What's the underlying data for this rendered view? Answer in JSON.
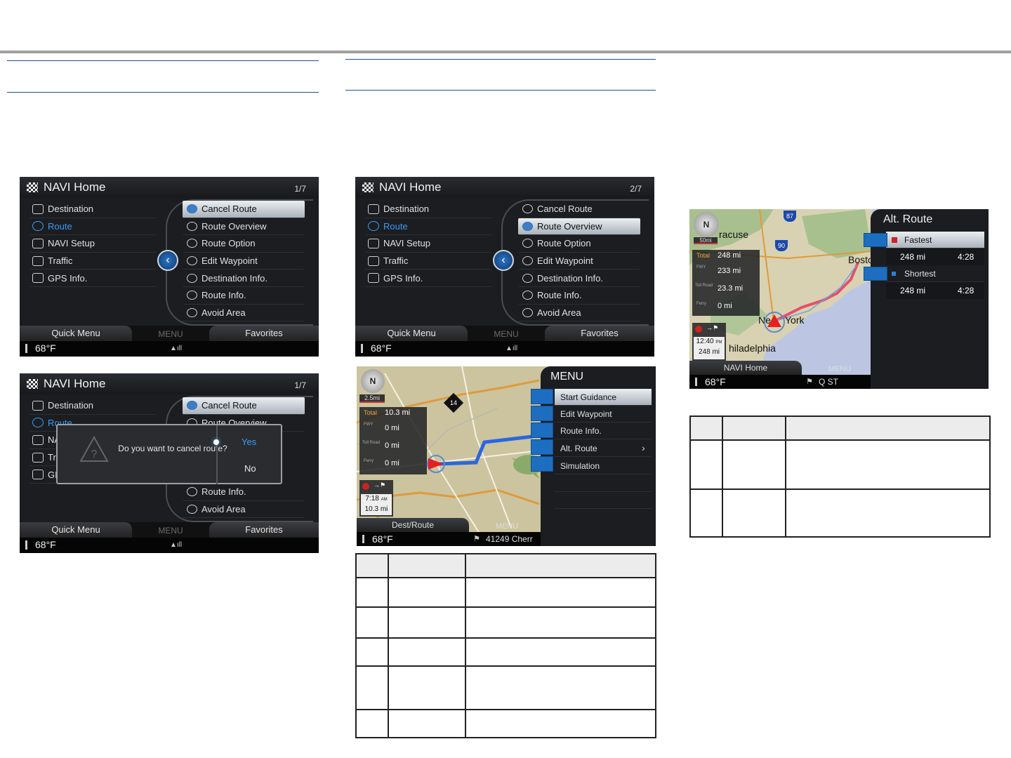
{
  "screen1": {
    "title": "NAVI Home",
    "page": "1/7",
    "left_menu": [
      "Destination",
      "Route",
      "NAVI Setup",
      "Traffic",
      "GPS Info."
    ],
    "right_menu": [
      "Cancel Route",
      "Route Overview",
      "Route Option",
      "Edit Waypoint",
      "Destination Info.",
      "Route Info.",
      "Avoid Area"
    ],
    "bottom": {
      "left": "Quick Menu",
      "center": "MENU",
      "right": "Favorites"
    },
    "temp": "68°F"
  },
  "screen2": {
    "title": "NAVI Home",
    "page": "1/7",
    "left_menu": [
      "Destination",
      "Route",
      "NA",
      "Tr",
      "GI"
    ],
    "right_menu_top": [
      "Cancel Route",
      "Route Overview"
    ],
    "right_menu_bottom": [
      "Route Info.",
      "Avoid Area"
    ],
    "dialog": {
      "message": "Do you want to cancel route?",
      "yes": "Yes",
      "no": "No"
    },
    "bottom": {
      "left": "Quick Menu",
      "center": "MENU",
      "right": "Favorites"
    },
    "temp": "68°F"
  },
  "screen3": {
    "title": "NAVI Home",
    "page": "2/7",
    "left_menu": [
      "Destination",
      "Route",
      "NAVI Setup",
      "Traffic",
      "GPS Info."
    ],
    "right_menu": [
      "Cancel Route",
      "Route Overview",
      "Route Option",
      "Edit Waypoint",
      "Destination Info.",
      "Route Info.",
      "Avoid Area"
    ],
    "bottom": {
      "left": "Quick Menu",
      "center": "MENU",
      "right": "Favorites"
    },
    "temp": "68°F"
  },
  "screen4": {
    "scale": "2.5mi",
    "total_label": "Total",
    "total": "10.3 mi",
    "rows": [
      {
        "label": "FWY",
        "value": "0 mi"
      },
      {
        "label": "Toll Road",
        "value": "0 mi"
      },
      {
        "label": "Ferry",
        "value": "0 mi"
      }
    ],
    "eta_time": "7:18",
    "eta_ampm": "AM",
    "eta_dist": "10.3 mi",
    "road_sign": "14",
    "menu_title": "MENU",
    "menu": [
      "Start Guidance",
      "Edit Waypoint",
      "Route Info.",
      "Alt. Route",
      "Simulation"
    ],
    "bottom": {
      "left": "Dest/Route",
      "center": "MENU",
      "street": "41249 Cherr"
    },
    "temp": "68°F"
  },
  "screen5": {
    "scale": "50mi",
    "total_label": "Total",
    "total": "248 mi",
    "rows": [
      {
        "label": "FWY",
        "value": "233 mi"
      },
      {
        "label": "Toll Road",
        "value": "23.3 mi"
      },
      {
        "label": "Ferry",
        "value": "0 mi"
      }
    ],
    "eta_time": "12:40",
    "eta_ampm": "PM",
    "eta_dist": "248 mi",
    "cities": [
      "racuse",
      "Bosto",
      "Ne",
      "York",
      "hiladelphia"
    ],
    "highways": [
      "87",
      "90"
    ],
    "panel_title": "Alt. Route",
    "options": [
      {
        "name": "Fastest",
        "dist": "248 mi",
        "time": "4:28",
        "color": "#d0202a"
      },
      {
        "name": "Shortest",
        "dist": "248 mi",
        "time": "4:28",
        "color": "#2f7fd8"
      }
    ],
    "bottom": {
      "left": "NAVI Home",
      "center": "MENU",
      "street": "Q ST"
    },
    "temp": "68°F"
  }
}
